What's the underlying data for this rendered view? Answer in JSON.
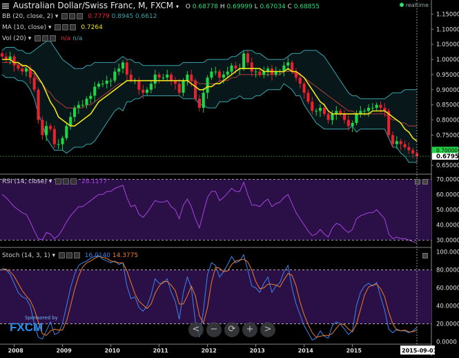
{
  "header": {
    "symbol_title": "Australian Dollar/Swiss Franc, M, FXCM",
    "open_label": "O",
    "open": "0.68778",
    "high_label": "H",
    "high": "0.69999",
    "low_label": "L",
    "low": "0.67034",
    "close_label": "C",
    "close": "0.68855",
    "realtime_label": "realtime"
  },
  "indicators": {
    "bb": {
      "label": "BB (20, close, 2)",
      "v1": "0.7779",
      "v2": "0.8945",
      "v3": "0.6612"
    },
    "ma": {
      "label": "MA (10, close)",
      "value": "0.7264"
    },
    "vol": {
      "label": "Vol (20)",
      "v1": "n/a",
      "v2": "n/a"
    },
    "rsi": {
      "label": "RSI (14, close)",
      "value": "28.1177"
    },
    "stoch": {
      "label": "Stoch (14, 3, 1)",
      "k": "16.0140",
      "d": "14.3775"
    }
  },
  "price_scale": {
    "ticks": [
      "1.15000",
      "1.10000",
      "1.05000",
      "1.00000",
      "0.95000",
      "0.90000",
      "0.85000",
      "0.80000",
      "0.75000",
      "0.70000",
      "0.65000"
    ],
    "last_price_tag": "0.67955",
    "hidden_tag": "0.70000"
  },
  "rsi_scale": {
    "ticks": [
      "70.0000",
      "60.0000",
      "50.0000",
      "40.0000",
      "30.0000"
    ]
  },
  "stoch_scale": {
    "ticks": [
      "100.0000",
      "80.0000",
      "60.0000",
      "40.0000",
      "20.0000",
      "0.0000"
    ]
  },
  "time_axis": {
    "labels": [
      "2008",
      "2009",
      "2010",
      "2011",
      "2012",
      "2013",
      "2014",
      "2015"
    ],
    "cursor_date": "2015-09-01"
  },
  "nav_buttons": [
    "<",
    "−",
    "⟳",
    "+",
    ">"
  ],
  "sponsor": {
    "line1": "Sponsored by",
    "logo": "FXCM"
  },
  "colors": {
    "up": "#1fd646",
    "down": "#e8222e",
    "ma": "#f2e51c",
    "bb": "#3aa5ad",
    "bb_mid": "#b33f3a",
    "rsi": "#a844e0",
    "stoch_k": "#3b86f0",
    "stoch_d": "#f07c2a",
    "band_fill": "#2a1046"
  },
  "chart_data": [
    {
      "type": "candlestick",
      "title": "Australian Dollar/Swiss Franc, M, FXCM",
      "x_start": "2007-10",
      "interval": "monthly",
      "ylim": [
        0.63,
        1.16
      ],
      "close": [
        1.01,
        1.0,
        1.01,
        0.98,
        0.97,
        0.96,
        0.97,
        0.94,
        0.9,
        0.8,
        0.75,
        0.78,
        0.77,
        0.72,
        0.72,
        0.74,
        0.78,
        0.81,
        0.84,
        0.85,
        0.85,
        0.87,
        0.88,
        0.91,
        0.92,
        0.92,
        0.93,
        0.93,
        0.96,
        0.97,
        0.99,
        0.95,
        0.93,
        0.93,
        0.9,
        0.89,
        0.9,
        0.92,
        0.95,
        0.94,
        0.94,
        0.95,
        0.93,
        0.92,
        0.89,
        0.93,
        0.95,
        0.93,
        0.87,
        0.84,
        0.89,
        0.94,
        0.96,
        0.96,
        0.94,
        0.95,
        0.96,
        0.98,
        0.97,
        0.97,
        1.02,
        0.99,
        0.96,
        0.96,
        0.95,
        0.96,
        0.97,
        0.95,
        0.96,
        0.96,
        0.98,
        0.99,
        0.96,
        0.94,
        0.92,
        0.89,
        0.86,
        0.83,
        0.83,
        0.84,
        0.82,
        0.8,
        0.82,
        0.83,
        0.82,
        0.8,
        0.78,
        0.79,
        0.82,
        0.83,
        0.83,
        0.84,
        0.84,
        0.85,
        0.84,
        0.83,
        0.75,
        0.72,
        0.73,
        0.72,
        0.71,
        0.7,
        0.69,
        0.68
      ],
      "bollinger": {
        "upper": [
          1.03,
          1.04,
          1.04,
          1.04,
          1.03,
          1.03,
          1.02,
          1.02,
          1.03,
          1.04,
          1.05,
          1.06,
          1.06,
          1.04,
          1.02,
          1.0,
          0.99,
          0.98,
          0.97,
          0.97,
          0.97,
          0.98,
          0.98,
          0.99,
          0.99,
          0.99,
          0.99,
          0.99,
          0.99,
          1.0,
          1.01,
          1.0,
          1.0,
          0.99,
          0.99,
          0.98,
          0.98,
          0.98,
          0.98,
          0.98,
          0.98,
          0.98,
          0.98,
          0.98,
          0.98,
          0.99,
          0.99,
          0.99,
          0.99,
          0.99,
          0.99,
          1.0,
          1.0,
          1.0,
          1.0,
          1.0,
          1.0,
          1.01,
          1.01,
          1.02,
          1.03,
          1.03,
          1.03,
          1.02,
          1.02,
          1.01,
          1.0,
          1.0,
          1.0,
          1.0,
          1.0,
          1.01,
          1.02,
          1.02,
          1.02,
          1.03,
          1.03,
          1.03,
          1.03,
          1.02,
          1.01,
          0.99,
          0.97,
          0.95,
          0.93,
          0.91,
          0.89,
          0.88,
          0.88,
          0.87,
          0.87,
          0.87,
          0.87,
          0.87,
          0.87,
          0.87,
          0.88,
          0.89,
          0.89,
          0.89,
          0.9,
          0.9,
          0.9,
          0.9
        ],
        "middle": [
          0.99,
          0.99,
          0.99,
          0.99,
          0.98,
          0.98,
          0.97,
          0.96,
          0.95,
          0.93,
          0.92,
          0.9,
          0.89,
          0.87,
          0.86,
          0.85,
          0.84,
          0.84,
          0.84,
          0.84,
          0.84,
          0.85,
          0.85,
          0.86,
          0.87,
          0.88,
          0.89,
          0.9,
          0.91,
          0.92,
          0.92,
          0.93,
          0.93,
          0.93,
          0.93,
          0.93,
          0.93,
          0.93,
          0.93,
          0.93,
          0.93,
          0.93,
          0.93,
          0.93,
          0.93,
          0.93,
          0.93,
          0.93,
          0.93,
          0.92,
          0.92,
          0.92,
          0.92,
          0.92,
          0.93,
          0.93,
          0.93,
          0.94,
          0.94,
          0.95,
          0.95,
          0.95,
          0.95,
          0.95,
          0.95,
          0.95,
          0.95,
          0.95,
          0.95,
          0.95,
          0.96,
          0.96,
          0.96,
          0.95,
          0.95,
          0.94,
          0.93,
          0.92,
          0.91,
          0.9,
          0.89,
          0.88,
          0.87,
          0.86,
          0.85,
          0.84,
          0.83,
          0.83,
          0.82,
          0.82,
          0.82,
          0.82,
          0.82,
          0.82,
          0.82,
          0.82,
          0.81,
          0.8,
          0.8,
          0.79,
          0.79,
          0.78,
          0.78,
          0.78
        ],
        "lower": [
          0.95,
          0.94,
          0.94,
          0.94,
          0.93,
          0.93,
          0.92,
          0.9,
          0.87,
          0.82,
          0.79,
          0.74,
          0.72,
          0.7,
          0.7,
          0.7,
          0.69,
          0.7,
          0.71,
          0.71,
          0.71,
          0.72,
          0.72,
          0.73,
          0.75,
          0.77,
          0.79,
          0.81,
          0.83,
          0.84,
          0.83,
          0.86,
          0.86,
          0.87,
          0.87,
          0.88,
          0.88,
          0.88,
          0.88,
          0.88,
          0.88,
          0.88,
          0.88,
          0.88,
          0.88,
          0.87,
          0.87,
          0.87,
          0.87,
          0.85,
          0.85,
          0.84,
          0.84,
          0.84,
          0.86,
          0.86,
          0.86,
          0.87,
          0.87,
          0.88,
          0.87,
          0.87,
          0.87,
          0.88,
          0.88,
          0.89,
          0.9,
          0.9,
          0.9,
          0.9,
          0.92,
          0.91,
          0.9,
          0.88,
          0.88,
          0.85,
          0.83,
          0.81,
          0.79,
          0.78,
          0.77,
          0.77,
          0.77,
          0.77,
          0.77,
          0.77,
          0.77,
          0.78,
          0.76,
          0.77,
          0.77,
          0.77,
          0.77,
          0.77,
          0.77,
          0.77,
          0.74,
          0.71,
          0.71,
          0.69,
          0.68,
          0.66,
          0.66,
          0.66
        ]
      },
      "ma10": [
        1.0,
        1.0,
        1.0,
        0.99,
        0.99,
        0.98,
        0.98,
        0.97,
        0.96,
        0.94,
        0.92,
        0.89,
        0.86,
        0.84,
        0.81,
        0.8,
        0.79,
        0.78,
        0.78,
        0.79,
        0.8,
        0.81,
        0.82,
        0.84,
        0.86,
        0.87,
        0.88,
        0.89,
        0.9,
        0.91,
        0.92,
        0.93,
        0.93,
        0.93,
        0.93,
        0.93,
        0.93,
        0.93,
        0.93,
        0.93,
        0.93,
        0.93,
        0.93,
        0.93,
        0.93,
        0.93,
        0.93,
        0.92,
        0.91,
        0.9,
        0.9,
        0.91,
        0.91,
        0.92,
        0.92,
        0.93,
        0.94,
        0.95,
        0.96,
        0.97,
        0.97,
        0.97,
        0.97,
        0.97,
        0.97,
        0.96,
        0.96,
        0.96,
        0.96,
        0.96,
        0.96,
        0.97,
        0.96,
        0.96,
        0.95,
        0.94,
        0.92,
        0.9,
        0.88,
        0.86,
        0.85,
        0.83,
        0.82,
        0.82,
        0.82,
        0.82,
        0.82,
        0.82,
        0.82,
        0.82,
        0.82,
        0.82,
        0.83,
        0.83,
        0.83,
        0.83,
        0.82,
        0.81,
        0.8,
        0.79,
        0.77,
        0.76,
        0.74,
        0.73
      ]
    },
    {
      "type": "line",
      "title": "RSI (14, close)",
      "ylim": [
        27,
        72
      ],
      "levels": [
        70,
        30
      ],
      "values": [
        60,
        58,
        55,
        52,
        50,
        48,
        47,
        42,
        36,
        31,
        30,
        35,
        34,
        31,
        33,
        37,
        42,
        46,
        49,
        52,
        52,
        54,
        56,
        58,
        60,
        60,
        62,
        62,
        64,
        65,
        66,
        58,
        52,
        53,
        47,
        45,
        48,
        52,
        56,
        55,
        55,
        56,
        52,
        50,
        44,
        53,
        57,
        52,
        44,
        38,
        48,
        58,
        62,
        62,
        56,
        58,
        61,
        64,
        62,
        62,
        68,
        60,
        53,
        53,
        52,
        55,
        57,
        52,
        54,
        55,
        58,
        60,
        54,
        48,
        44,
        40,
        36,
        33,
        34,
        37,
        34,
        32,
        38,
        41,
        40,
        37,
        35,
        37,
        44,
        46,
        47,
        48,
        48,
        50,
        47,
        44,
        34,
        31,
        32,
        31,
        31,
        30,
        29,
        28
      ]
    },
    {
      "type": "line",
      "title": "Stoch (14, 3, 1)",
      "ylim": [
        -2,
        102
      ],
      "levels": [
        80,
        20
      ],
      "series": [
        {
          "name": "%K",
          "values": [
            82,
            80,
            75,
            65,
            55,
            50,
            48,
            40,
            20,
            5,
            3,
            12,
            22,
            8,
            10,
            20,
            40,
            60,
            75,
            85,
            88,
            90,
            93,
            95,
            96,
            92,
            90,
            88,
            90,
            86,
            88,
            62,
            48,
            50,
            38,
            34,
            40,
            52,
            70,
            65,
            65,
            70,
            55,
            45,
            25,
            55,
            72,
            60,
            22,
            5,
            35,
            75,
            88,
            85,
            72,
            78,
            86,
            95,
            88,
            90,
            97,
            80,
            62,
            60,
            55,
            65,
            72,
            55,
            62,
            66,
            78,
            85,
            60,
            42,
            30,
            18,
            10,
            2,
            4,
            12,
            6,
            4,
            18,
            22,
            20,
            14,
            8,
            12,
            40,
            55,
            62,
            65,
            62,
            66,
            50,
            35,
            14,
            10,
            14,
            12,
            12,
            10,
            12,
            16
          ]
        },
        {
          "name": "%D",
          "values": [
            80,
            81,
            78,
            73,
            65,
            57,
            51,
            46,
            36,
            22,
            9,
            7,
            12,
            14,
            13,
            13,
            23,
            40,
            58,
            73,
            83,
            88,
            90,
            93,
            95,
            94,
            93,
            90,
            89,
            88,
            88,
            79,
            66,
            53,
            45,
            41,
            37,
            42,
            54,
            62,
            67,
            67,
            63,
            57,
            42,
            42,
            51,
            62,
            51,
            29,
            21,
            38,
            66,
            83,
            82,
            78,
            79,
            86,
            90,
            91,
            92,
            89,
            80,
            67,
            59,
            60,
            64,
            64,
            63,
            61,
            69,
            76,
            74,
            62,
            44,
            30,
            19,
            10,
            5,
            6,
            7,
            7,
            9,
            15,
            20,
            19,
            14,
            11,
            20,
            36,
            52,
            61,
            63,
            64,
            59,
            50,
            33,
            20,
            13,
            12,
            13,
            11,
            11,
            13
          ]
        }
      ]
    },
    {
      "type": "bar",
      "title": "Vol (20)",
      "values": []
    }
  ]
}
